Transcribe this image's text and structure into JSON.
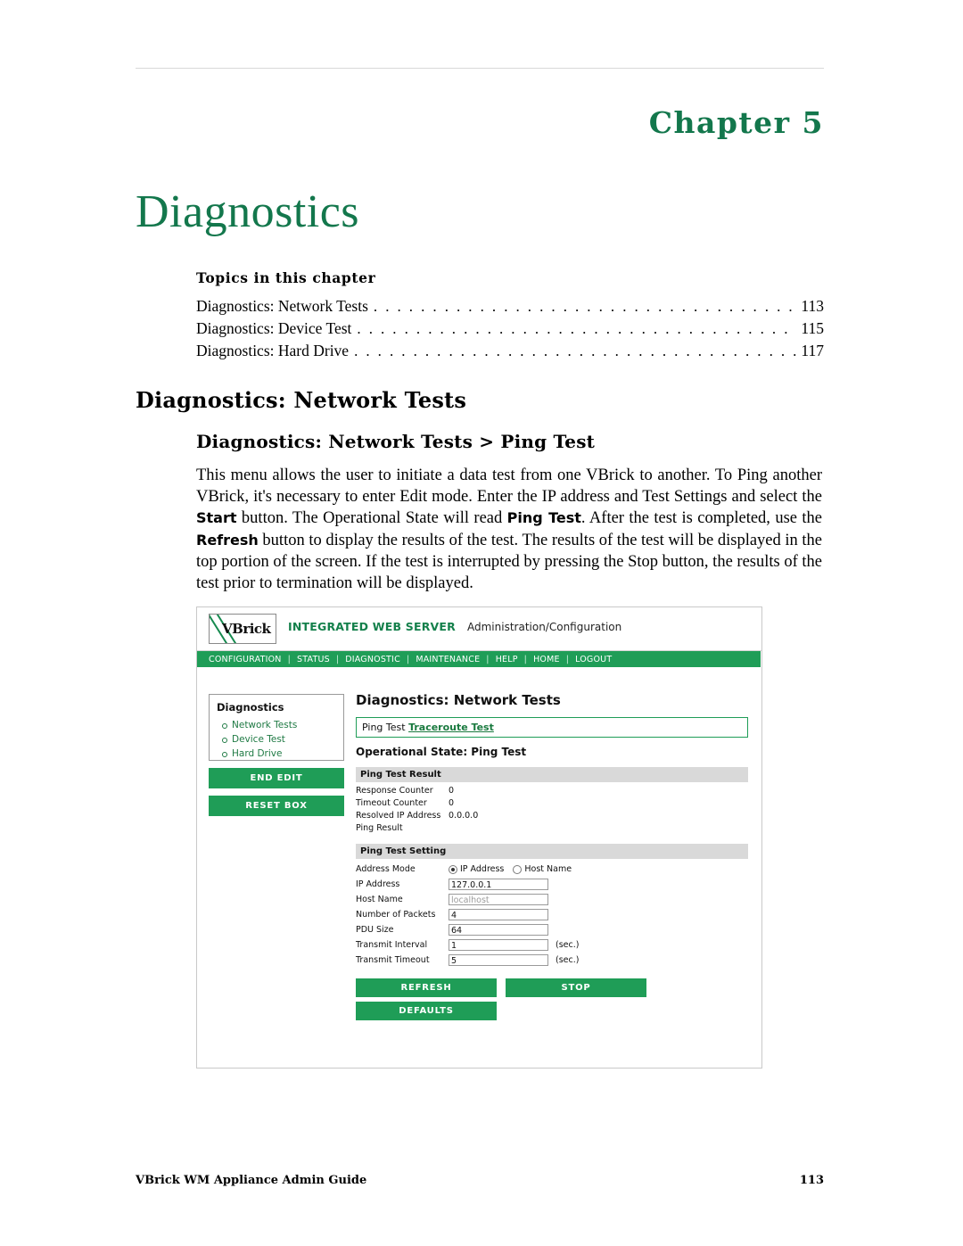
{
  "page": {
    "chapter_label": "Chapter  5",
    "chapter_title": "Diagnostics",
    "topics_heading": "Topics in this chapter",
    "toc": [
      {
        "text": "Diagnostics: Network Tests",
        "page": "113"
      },
      {
        "text": "Diagnostics: Device Test",
        "page": "115"
      },
      {
        "text": "Diagnostics: Hard Drive",
        "page": "117"
      }
    ],
    "h1": "Diagnostics: Network Tests",
    "h2": "Diagnostics: Network Tests > Ping Test",
    "paragraph_parts": [
      {
        "t": "This menu allows the user to initiate a data test from one VBrick to another. To Ping another VBrick, it's necessary to enter Edit mode. Enter the IP address and Test Settings and select the ",
        "b": false
      },
      {
        "t": "Start",
        "b": true
      },
      {
        "t": " button. The Operational State will read ",
        "b": false
      },
      {
        "t": "Ping Test",
        "b": true
      },
      {
        "t": ". After the test is completed, use the ",
        "b": false
      },
      {
        "t": "Refresh",
        "b": true
      },
      {
        "t": " button to display the results of the test. The results of the test will be displayed in the top portion of the screen. If the test is interrupted by pressing the Stop button, the results of the test prior to termination will be displayed.",
        "b": false
      }
    ],
    "footer_left": "VBrick WM Appliance Admin Guide",
    "footer_right": "113"
  },
  "figure": {
    "logo_text": "VBrick",
    "server_title": "INTEGRATED WEB SERVER",
    "admin_config": "Administration/Configuration",
    "nav": [
      "CONFIGURATION",
      "STATUS",
      "DIAGNOSTIC",
      "MAINTENANCE",
      "HELP",
      "HOME",
      "LOGOUT"
    ],
    "sidebar": {
      "title": "Diagnostics",
      "items": [
        "Network Tests",
        "Device Test",
        "Hard Drive"
      ],
      "buttons": [
        "END EDIT",
        "RESET BOX"
      ]
    },
    "content": {
      "title": "Diagnostics: Network Tests",
      "tab_plain": "Ping Test",
      "tab_link": "Traceroute Test",
      "operational_state": "Operational State: Ping Test",
      "result_section": "Ping Test Result",
      "results": [
        {
          "label": "Response Counter",
          "value": "0"
        },
        {
          "label": "Timeout Counter",
          "value": "0"
        },
        {
          "label": "Resolved IP Address",
          "value": "0.0.0.0"
        },
        {
          "label": "Ping Result",
          "value": ""
        }
      ],
      "setting_section": "Ping Test Setting",
      "address_mode_label": "Address Mode",
      "address_mode_options": [
        {
          "label": "IP Address",
          "selected": true
        },
        {
          "label": "Host Name",
          "selected": false
        }
      ],
      "fields": [
        {
          "label": "IP Address",
          "value": "127.0.0.1",
          "placeholder": false,
          "unit": ""
        },
        {
          "label": "Host Name",
          "value": "localhost",
          "placeholder": true,
          "unit": ""
        },
        {
          "label": "Number of Packets",
          "value": "4",
          "placeholder": false,
          "unit": ""
        },
        {
          "label": "PDU Size",
          "value": "64",
          "placeholder": false,
          "unit": ""
        },
        {
          "label": "Transmit Interval",
          "value": "1",
          "placeholder": false,
          "unit": "(sec.)"
        },
        {
          "label": "Transmit Timeout",
          "value": "5",
          "placeholder": false,
          "unit": "(sec.)"
        }
      ],
      "buttons": [
        "REFRESH",
        "STOP",
        "DEFAULTS"
      ]
    }
  },
  "colors": {
    "brand_green": "#1f9d57",
    "heading_green": "#13774c",
    "section_gray": "#d9d9d9"
  }
}
